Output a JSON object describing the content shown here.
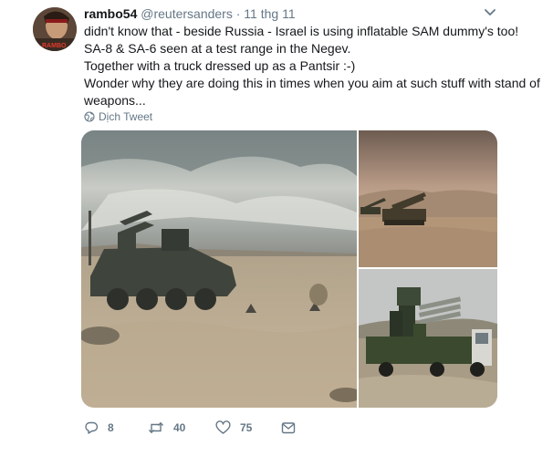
{
  "tweet": {
    "display_name": "rambo54",
    "handle": "@reutersanders",
    "separator": "·",
    "timestamp": "11 thg 11",
    "avatar_text": "RAMBO",
    "lines": [
      "didn't know that - beside Russia - Israel is using inflatable SAM dummy's too!",
      "SA-8 & SA-6 seen at a test range in the Negev.",
      "Together with a truck dressed up as a Pantsir :-)",
      "Wonder why they are doing this in times when you aim at such stuff with stand of",
      "weapons..."
    ],
    "translate_label": "Dịch Tweet"
  },
  "actions": {
    "reply_count": "8",
    "retweet_count": "40",
    "like_count": "75"
  },
  "colors": {
    "text": "#14171a",
    "secondary": "#657786",
    "background": "#ffffff"
  },
  "icons": [
    "chevron-down-icon",
    "globe-icon",
    "reply-icon",
    "retweet-icon",
    "like-icon",
    "share-icon"
  ]
}
